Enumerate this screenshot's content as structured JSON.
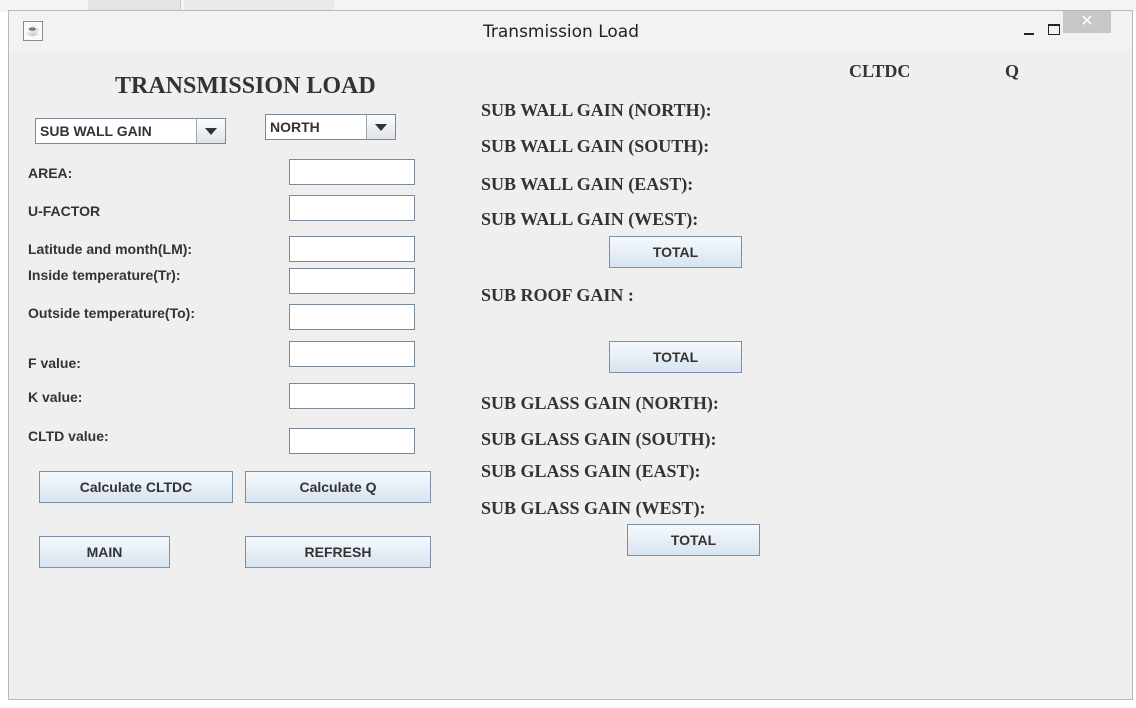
{
  "window": {
    "title": "Transmission Load"
  },
  "heading": "TRANSMISSION LOAD",
  "selectors": {
    "type_value": "SUB WALL GAIN",
    "direction_value": "NORTH"
  },
  "form": {
    "area": "AREA:",
    "u_factor": "U-FACTOR",
    "latitude_month": "Latitude and month(LM):",
    "inside_temp": "Inside temperature(Tr):",
    "outside_temp": "Outside temperature(To):",
    "f_value": "F value:",
    "k_value": "K value:",
    "cltd_value": "CLTD value:"
  },
  "buttons": {
    "calc_cltdc": "Calculate CLTDC",
    "calc_q": "Calculate Q",
    "main": "MAIN",
    "refresh": "REFRESH",
    "total": "TOTAL"
  },
  "results": {
    "col_cltdc": "CLTDC",
    "col_q": "Q",
    "wall_north": "SUB WALL GAIN (NORTH):",
    "wall_south": "SUB WALL GAIN (SOUTH):",
    "wall_east": "SUB WALL GAIN (EAST):",
    "wall_west": "SUB WALL GAIN (WEST):",
    "roof": "SUB ROOF GAIN :",
    "glass_north": "SUB GLASS GAIN (NORTH):",
    "glass_south": "SUB GLASS GAIN (SOUTH):",
    "glass_east": "SUB GLASS GAIN (EAST):",
    "glass_west": "SUB GLASS GAIN (WEST):"
  }
}
